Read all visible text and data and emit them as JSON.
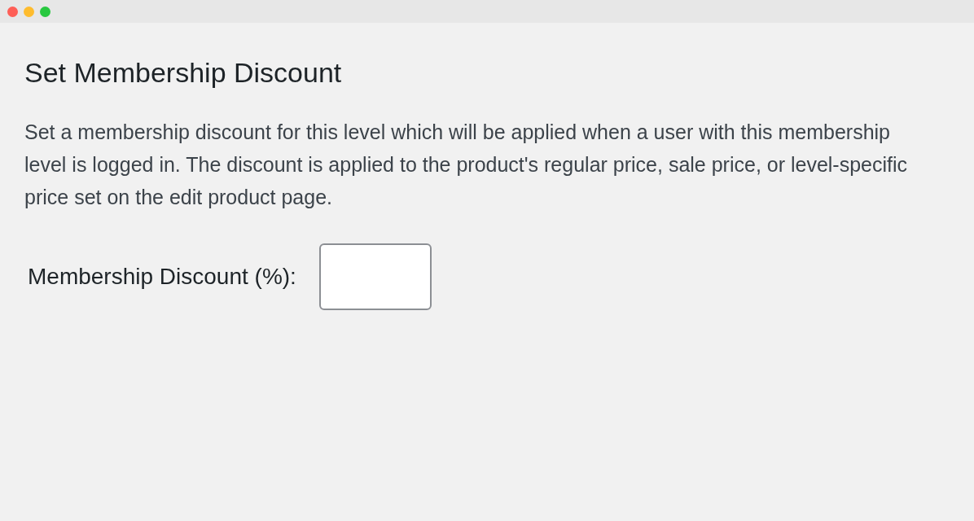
{
  "heading": "Set Membership Discount",
  "description": "Set a membership discount for this level which will be applied when a user with this membership level is logged in. The discount is applied to the product's regular price, sale price, or level-specific price set on the edit product page.",
  "discount_field": {
    "label": "Membership Discount (%):"
  }
}
